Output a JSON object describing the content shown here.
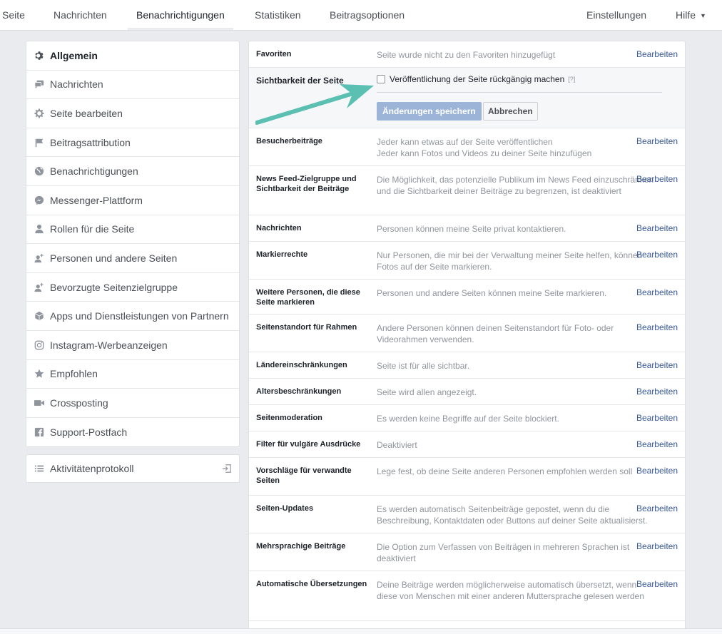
{
  "topnav": {
    "items": [
      "Seite",
      "Nachrichten",
      "Benachrichtigungen",
      "Statistiken",
      "Beitragsoptionen"
    ],
    "settings": "Einstellungen",
    "help": "Hilfe"
  },
  "sidebar": {
    "items": [
      {
        "label": "Allgemein",
        "icon": "gear-icon"
      },
      {
        "label": "Nachrichten",
        "icon": "chat-icon"
      },
      {
        "label": "Seite bearbeiten",
        "icon": "gear-icon"
      },
      {
        "label": "Beitragsattribution",
        "icon": "flag-icon"
      },
      {
        "label": "Benachrichtigungen",
        "icon": "globe-icon"
      },
      {
        "label": "Messenger-Plattform",
        "icon": "messenger-icon"
      },
      {
        "label": "Rollen für die Seite",
        "icon": "person-icon"
      },
      {
        "label": "Personen und andere Seiten",
        "icon": "person-add-icon"
      },
      {
        "label": "Bevorzugte Seitenzielgruppe",
        "icon": "person-add-icon"
      },
      {
        "label": "Apps und Dienstleistungen von Partnern",
        "icon": "cube-icon"
      },
      {
        "label": "Instagram-Werbeanzeigen",
        "icon": "instagram-icon"
      },
      {
        "label": "Empfohlen",
        "icon": "star-icon"
      },
      {
        "label": "Crossposting",
        "icon": "video-icon"
      },
      {
        "label": "Support-Postfach",
        "icon": "facebook-icon"
      }
    ],
    "activity": "Aktivitätenprotokoll"
  },
  "main": {
    "edit_label": "Bearbeiten",
    "favorites": {
      "label": "Favoriten",
      "desc": "Seite wurde nicht zu den Favoriten hinzugefügt"
    },
    "visibility": {
      "label": "Sichtbarkeit der Seite",
      "checkbox": "Veröffentlichung der Seite rückgängig machen",
      "help": "[?]",
      "save": "Änderungen speichern",
      "cancel": "Abbrechen"
    },
    "rows": [
      {
        "label": "Besucherbeiträge",
        "desc": "Jeder kann etwas auf der Seite veröffentlichen\nJeder kann Fotos und Videos zu deiner Seite hinzufügen"
      },
      {
        "label": "News Feed-Zielgruppe und Sichtbarkeit der Beiträge",
        "desc": "Die Möglichkeit, das potenzielle Publikum im News Feed einzuschränken und die Sichtbarkeit deiner Beiträge zu begrenzen, ist deaktiviert"
      },
      {
        "label": "Nachrichten",
        "desc": "Personen können meine Seite privat kontaktieren."
      },
      {
        "label": "Markierrechte",
        "desc": "Nur Personen, die mir bei der Verwaltung meiner Seite helfen, können Fotos auf der Seite markieren."
      },
      {
        "label": "Weitere Personen, die diese Seite markieren",
        "desc": "Personen und andere Seiten können meine Seite markieren."
      },
      {
        "label": "Seitenstandort für Rahmen",
        "desc": "Andere Personen können deinen Seitenstandort für Foto- oder Videorahmen verwenden."
      },
      {
        "label": "Ländereinschränkungen",
        "desc": "Seite ist für alle sichtbar."
      },
      {
        "label": "Altersbeschränkungen",
        "desc": "Seite wird allen angezeigt."
      },
      {
        "label": "Seitenmoderation",
        "desc": "Es werden keine Begriffe auf der Seite blockiert."
      },
      {
        "label": "Filter für vulgäre Ausdrücke",
        "desc": "Deaktiviert"
      },
      {
        "label": "Vorschläge für verwandte Seiten",
        "desc": "Lege fest, ob deine Seite anderen Personen empfohlen werden soll"
      },
      {
        "label": "Seiten-Updates",
        "desc": "Es werden automatisch Seitenbeiträge gepostet, wenn du die Beschreibung, Kontaktdaten oder Buttons auf deiner Seite aktualisierst."
      },
      {
        "label": "Mehrsprachige Beiträge",
        "desc": "Die Option zum Verfassen von Beiträgen in mehreren Sprachen ist deaktiviert"
      },
      {
        "label": "Automatische Übersetzungen",
        "desc": "Deine Beiträge werden möglicherweise automatisch übersetzt, wenn diese von Menschen mit einer anderen Muttersprache gelesen werden"
      }
    ]
  },
  "colors": {
    "accent": "#365899",
    "arrow": "#5bbfb2",
    "save_button": "#9cb4d8"
  }
}
